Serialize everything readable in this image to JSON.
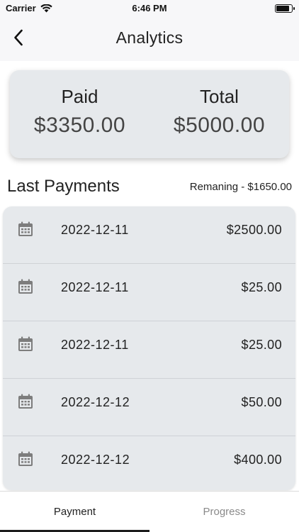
{
  "status_bar": {
    "carrier": "Carrier",
    "time": "6:46 PM"
  },
  "nav": {
    "title": "Analytics",
    "back_icon": "chevron-left-icon"
  },
  "summary": {
    "paid_label": "Paid",
    "paid_value": "$3350.00",
    "total_label": "Total",
    "total_value": "$5000.00"
  },
  "payments_section": {
    "title": "Last Payments",
    "remaining": "Remaning - $1650.00"
  },
  "payments": [
    {
      "date": "2022-12-11",
      "amount": "$2500.00"
    },
    {
      "date": "2022-12-11",
      "amount": "$25.00"
    },
    {
      "date": "2022-12-11",
      "amount": "$25.00"
    },
    {
      "date": "2022-12-12",
      "amount": "$50.00"
    },
    {
      "date": "2022-12-12",
      "amount": "$400.00"
    }
  ],
  "tabs": [
    {
      "label": "Payment",
      "active": true
    },
    {
      "label": "Progress",
      "active": false
    }
  ],
  "colors": {
    "card_bg": "#e6e9ec",
    "bar_bg": "#f7f7f9",
    "icon_gray": "#7d7d7d",
    "active_tab": "#1c1c1c",
    "inactive_tab": "#8a8a8a"
  }
}
